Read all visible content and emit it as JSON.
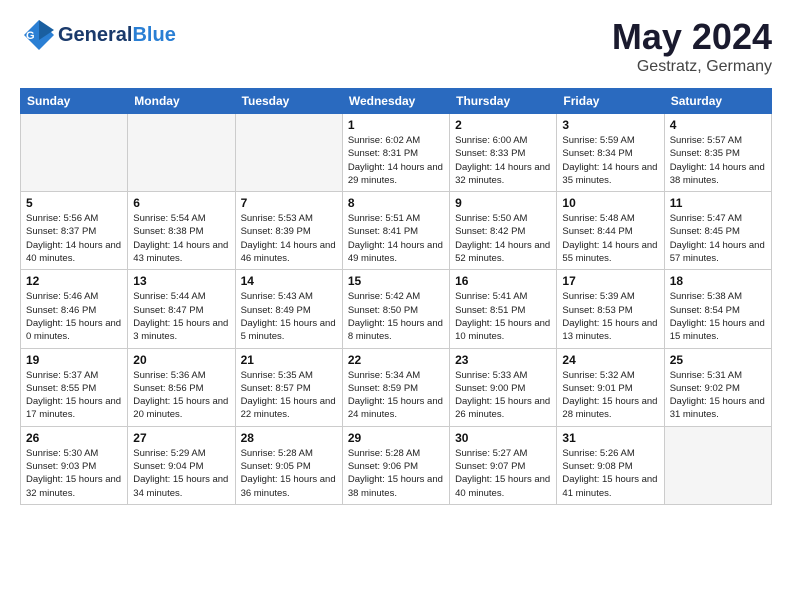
{
  "header": {
    "logo_general": "General",
    "logo_blue": "Blue",
    "title": "May 2024",
    "location": "Gestratz, Germany"
  },
  "weekdays": [
    "Sunday",
    "Monday",
    "Tuesday",
    "Wednesday",
    "Thursday",
    "Friday",
    "Saturday"
  ],
  "weeks": [
    [
      {
        "day": "",
        "info": ""
      },
      {
        "day": "",
        "info": ""
      },
      {
        "day": "",
        "info": ""
      },
      {
        "day": "1",
        "info": "Sunrise: 6:02 AM\nSunset: 8:31 PM\nDaylight: 14 hours\nand 29 minutes."
      },
      {
        "day": "2",
        "info": "Sunrise: 6:00 AM\nSunset: 8:33 PM\nDaylight: 14 hours\nand 32 minutes."
      },
      {
        "day": "3",
        "info": "Sunrise: 5:59 AM\nSunset: 8:34 PM\nDaylight: 14 hours\nand 35 minutes."
      },
      {
        "day": "4",
        "info": "Sunrise: 5:57 AM\nSunset: 8:35 PM\nDaylight: 14 hours\nand 38 minutes."
      }
    ],
    [
      {
        "day": "5",
        "info": "Sunrise: 5:56 AM\nSunset: 8:37 PM\nDaylight: 14 hours\nand 40 minutes."
      },
      {
        "day": "6",
        "info": "Sunrise: 5:54 AM\nSunset: 8:38 PM\nDaylight: 14 hours\nand 43 minutes."
      },
      {
        "day": "7",
        "info": "Sunrise: 5:53 AM\nSunset: 8:39 PM\nDaylight: 14 hours\nand 46 minutes."
      },
      {
        "day": "8",
        "info": "Sunrise: 5:51 AM\nSunset: 8:41 PM\nDaylight: 14 hours\nand 49 minutes."
      },
      {
        "day": "9",
        "info": "Sunrise: 5:50 AM\nSunset: 8:42 PM\nDaylight: 14 hours\nand 52 minutes."
      },
      {
        "day": "10",
        "info": "Sunrise: 5:48 AM\nSunset: 8:44 PM\nDaylight: 14 hours\nand 55 minutes."
      },
      {
        "day": "11",
        "info": "Sunrise: 5:47 AM\nSunset: 8:45 PM\nDaylight: 14 hours\nand 57 minutes."
      }
    ],
    [
      {
        "day": "12",
        "info": "Sunrise: 5:46 AM\nSunset: 8:46 PM\nDaylight: 15 hours\nand 0 minutes."
      },
      {
        "day": "13",
        "info": "Sunrise: 5:44 AM\nSunset: 8:47 PM\nDaylight: 15 hours\nand 3 minutes."
      },
      {
        "day": "14",
        "info": "Sunrise: 5:43 AM\nSunset: 8:49 PM\nDaylight: 15 hours\nand 5 minutes."
      },
      {
        "day": "15",
        "info": "Sunrise: 5:42 AM\nSunset: 8:50 PM\nDaylight: 15 hours\nand 8 minutes."
      },
      {
        "day": "16",
        "info": "Sunrise: 5:41 AM\nSunset: 8:51 PM\nDaylight: 15 hours\nand 10 minutes."
      },
      {
        "day": "17",
        "info": "Sunrise: 5:39 AM\nSunset: 8:53 PM\nDaylight: 15 hours\nand 13 minutes."
      },
      {
        "day": "18",
        "info": "Sunrise: 5:38 AM\nSunset: 8:54 PM\nDaylight: 15 hours\nand 15 minutes."
      }
    ],
    [
      {
        "day": "19",
        "info": "Sunrise: 5:37 AM\nSunset: 8:55 PM\nDaylight: 15 hours\nand 17 minutes."
      },
      {
        "day": "20",
        "info": "Sunrise: 5:36 AM\nSunset: 8:56 PM\nDaylight: 15 hours\nand 20 minutes."
      },
      {
        "day": "21",
        "info": "Sunrise: 5:35 AM\nSunset: 8:57 PM\nDaylight: 15 hours\nand 22 minutes."
      },
      {
        "day": "22",
        "info": "Sunrise: 5:34 AM\nSunset: 8:59 PM\nDaylight: 15 hours\nand 24 minutes."
      },
      {
        "day": "23",
        "info": "Sunrise: 5:33 AM\nSunset: 9:00 PM\nDaylight: 15 hours\nand 26 minutes."
      },
      {
        "day": "24",
        "info": "Sunrise: 5:32 AM\nSunset: 9:01 PM\nDaylight: 15 hours\nand 28 minutes."
      },
      {
        "day": "25",
        "info": "Sunrise: 5:31 AM\nSunset: 9:02 PM\nDaylight: 15 hours\nand 31 minutes."
      }
    ],
    [
      {
        "day": "26",
        "info": "Sunrise: 5:30 AM\nSunset: 9:03 PM\nDaylight: 15 hours\nand 32 minutes."
      },
      {
        "day": "27",
        "info": "Sunrise: 5:29 AM\nSunset: 9:04 PM\nDaylight: 15 hours\nand 34 minutes."
      },
      {
        "day": "28",
        "info": "Sunrise: 5:28 AM\nSunset: 9:05 PM\nDaylight: 15 hours\nand 36 minutes."
      },
      {
        "day": "29",
        "info": "Sunrise: 5:28 AM\nSunset: 9:06 PM\nDaylight: 15 hours\nand 38 minutes."
      },
      {
        "day": "30",
        "info": "Sunrise: 5:27 AM\nSunset: 9:07 PM\nDaylight: 15 hours\nand 40 minutes."
      },
      {
        "day": "31",
        "info": "Sunrise: 5:26 AM\nSunset: 9:08 PM\nDaylight: 15 hours\nand 41 minutes."
      },
      {
        "day": "",
        "info": ""
      }
    ]
  ]
}
